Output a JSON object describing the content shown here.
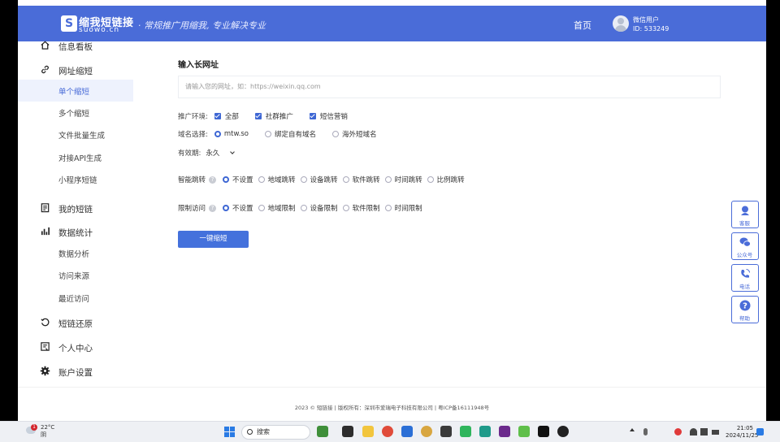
{
  "header": {
    "logo_mark": "S",
    "logo_name": "缩我短链接",
    "logo_domain": "suowo.cn",
    "slogan": "· 常规推广用缩我, 专业解决专业",
    "nav_home": "首页",
    "user_name": "微信用户",
    "user_id": "ID: 533249"
  },
  "sidebar": {
    "items": [
      {
        "label": "信息看板",
        "icon": "home-icon"
      },
      {
        "label": "网址缩短",
        "icon": "link-icon"
      },
      {
        "label": "我的短链",
        "icon": "list-icon"
      },
      {
        "label": "数据统计",
        "icon": "bar-chart-icon"
      },
      {
        "label": "短链还原",
        "icon": "restore-icon"
      },
      {
        "label": "个人中心",
        "icon": "profile-icon"
      },
      {
        "label": "账户设置",
        "icon": "gear-icon"
      }
    ],
    "shorten_sub": [
      "单个缩短",
      "多个缩短",
      "文件批量生成",
      "对接API生成",
      "小程序短链"
    ],
    "stats_sub": [
      "数据分析",
      "访问来源",
      "最近访问"
    ]
  },
  "main": {
    "section_title": "输入长网址",
    "url_placeholder": "请输入您的网址，如：https://weixin.qq.com",
    "env_label": "推广环境:",
    "env_options": [
      "全部",
      "社群推广",
      "短信营销"
    ],
    "domain_label": "域名选择:",
    "domain_options": [
      "mtw.so",
      "绑定自有域名",
      "海外短域名"
    ],
    "validity_label": "有效期:",
    "validity_value": "永久",
    "smart_label": "智能跳转",
    "smart_options": [
      "不设置",
      "地域跳转",
      "设备跳转",
      "软件跳转",
      "时间跳转",
      "比例跳转"
    ],
    "limit_label": "限制访问",
    "limit_options": [
      "不设置",
      "地域限制",
      "设备限制",
      "软件限制",
      "时间限制"
    ],
    "submit": "一键缩短"
  },
  "float_buttons": [
    "客服",
    "公众号",
    "电话",
    "帮助"
  ],
  "footer": "2023 © 短链接 | 版权所有：深圳市爱瑞电子科技有限公司 | 粤ICP备16111948号",
  "taskbar": {
    "weather_temp": "22°C",
    "weather_desc": "阴",
    "weather_badge": "1",
    "search_label": "搜索",
    "time": "21:05",
    "date": "2024/11/25"
  },
  "colors": {
    "brand": "#4a6cd8",
    "button": "#4471dc"
  }
}
